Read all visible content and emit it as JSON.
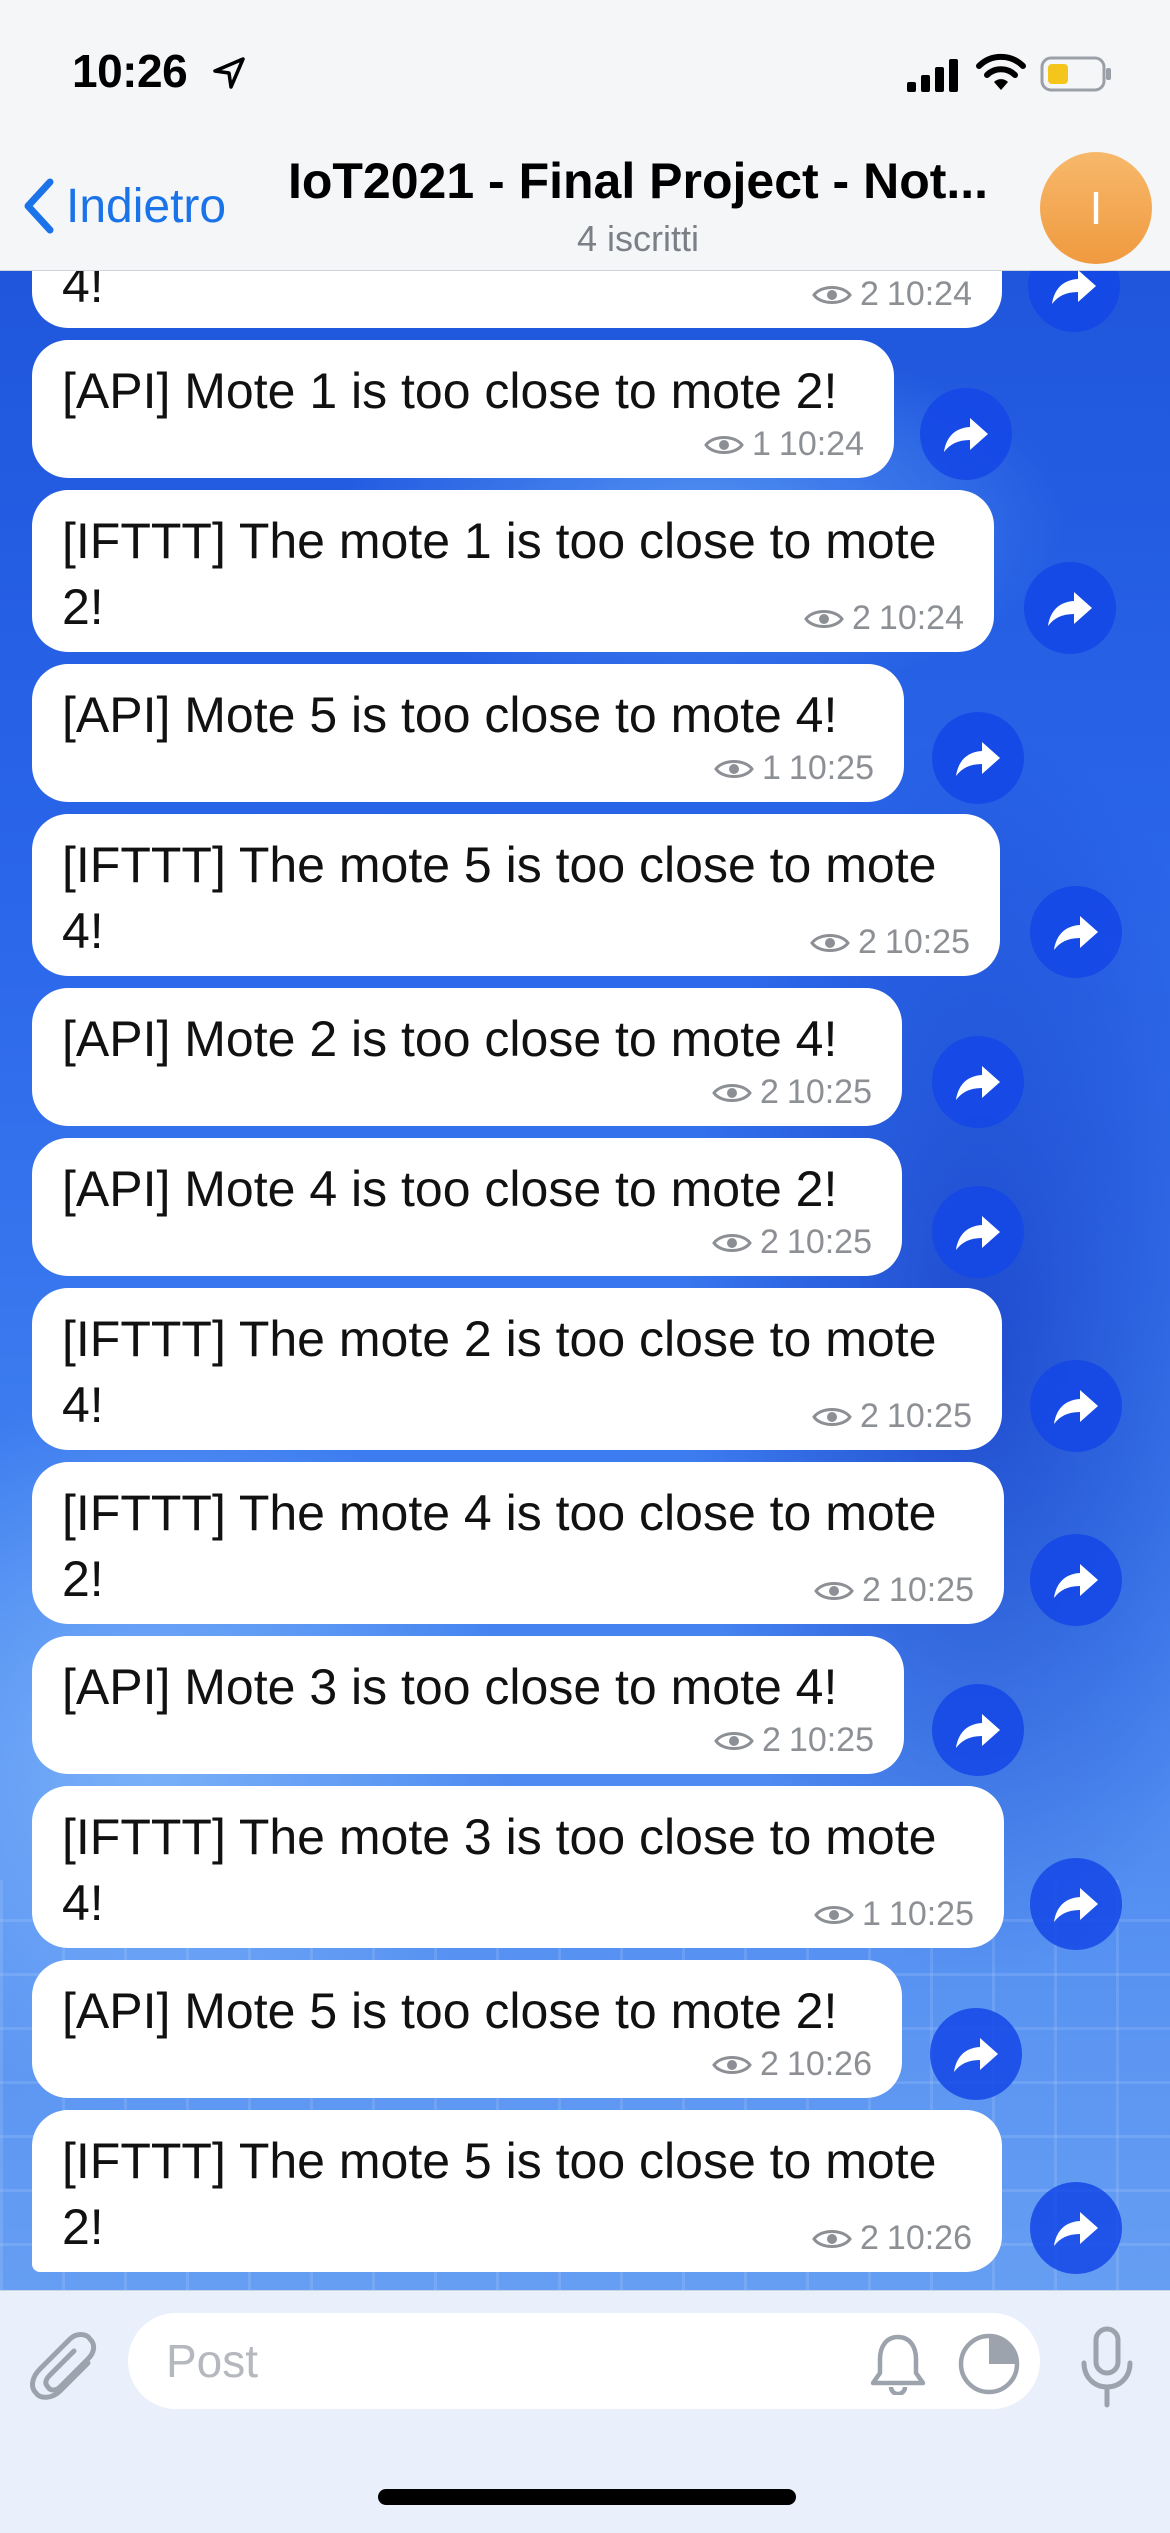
{
  "status_bar": {
    "time": "10:26"
  },
  "header": {
    "back_label": "Indietro",
    "title": "IoT2021 - Final Project - Not...",
    "subtitle": "4 iscritti",
    "avatar_letter": "I",
    "avatar_color": "#f2a54a"
  },
  "messages": [
    {
      "text": "4!",
      "views": "2",
      "time": "10:24"
    },
    {
      "text": "[API] Mote 1 is too close to mote 2!",
      "views": "1",
      "time": "10:24"
    },
    {
      "text": "[IFTTT] The mote 1 is too close to mote\n2!",
      "views": "2",
      "time": "10:24"
    },
    {
      "text": "[API] Mote 5 is too close to mote 4!",
      "views": "1",
      "time": "10:25"
    },
    {
      "text": "[IFTTT] The mote 5 is too close to mote\n4!",
      "views": "2",
      "time": "10:25"
    },
    {
      "text": "[API] Mote 2 is too close to mote 4!",
      "views": "2",
      "time": "10:25"
    },
    {
      "text": "[API] Mote 4 is too close to mote 2!",
      "views": "2",
      "time": "10:25"
    },
    {
      "text": "[IFTTT] The mote 2 is too close to mote\n4!",
      "views": "2",
      "time": "10:25"
    },
    {
      "text": "[IFTTT] The mote 4 is too close to mote\n2!",
      "views": "2",
      "time": "10:25"
    },
    {
      "text": "[API] Mote 3 is too close to mote 4!",
      "views": "2",
      "time": "10:25"
    },
    {
      "text": "[IFTTT] The mote 3 is too close to mote\n4!",
      "views": "1",
      "time": "10:25"
    },
    {
      "text": "[API] Mote 5 is too close to mote 2!",
      "views": "2",
      "time": "10:26"
    },
    {
      "text": "[IFTTT] The mote 5 is too close to mote\n2!",
      "views": "2",
      "time": "10:26"
    }
  ],
  "composer": {
    "placeholder": "Post"
  },
  "colors": {
    "accent": "#1a73e8",
    "forward_bg": "#1446e6"
  }
}
